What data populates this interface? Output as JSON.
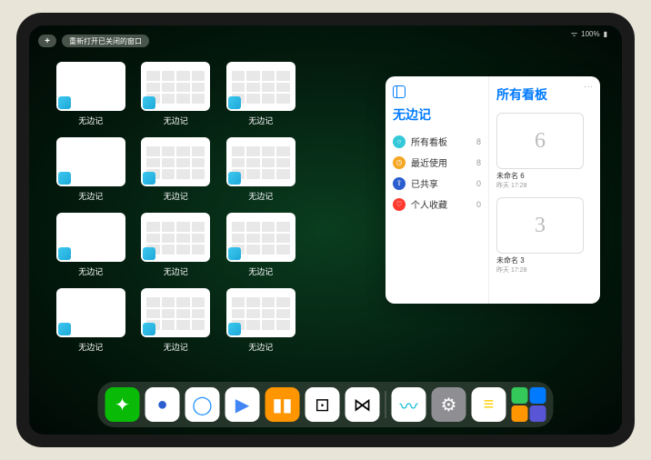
{
  "status": {
    "wifi": "wifi",
    "battery": "100%"
  },
  "controls": {
    "add": "+",
    "reopen": "重新打开已关闭的窗口"
  },
  "app_name": "无边记",
  "stage": {
    "windows": [
      {
        "type": "empty"
      },
      {
        "type": "grid"
      },
      {
        "type": "grid"
      },
      null,
      {
        "type": "empty"
      },
      {
        "type": "grid"
      },
      {
        "type": "grid"
      },
      null,
      {
        "type": "empty"
      },
      {
        "type": "grid"
      },
      {
        "type": "grid"
      },
      null,
      {
        "type": "empty"
      },
      {
        "type": "grid"
      },
      {
        "type": "grid"
      },
      null
    ]
  },
  "panel": {
    "left_title": "无边记",
    "right_title": "所有看板",
    "menu": "···",
    "items": [
      {
        "icon_color": "#34c8d9",
        "icon": "○",
        "label": "所有看板",
        "count": "8"
      },
      {
        "icon_color": "#f5a623",
        "icon": "◷",
        "label": "最近使用",
        "count": "8"
      },
      {
        "icon_color": "#2b5fcf",
        "icon": "⇪",
        "label": "已共享",
        "count": "0"
      },
      {
        "icon_color": "#ff3b30",
        "icon": "♡",
        "label": "个人收藏",
        "count": "0"
      }
    ],
    "boards": [
      {
        "glyph": "6",
        "name": "未命名 6",
        "time": "昨天 17:28"
      },
      {
        "glyph": "3",
        "name": "未命名 3",
        "time": "昨天 17:28"
      }
    ]
  },
  "dock": {
    "apps": [
      {
        "name": "wechat",
        "bg": "#09bb07",
        "glyph": "✦"
      },
      {
        "name": "quark",
        "bg": "#ffffff",
        "glyph": "●",
        "fg": "#2b5fcf"
      },
      {
        "name": "qqbrowser",
        "bg": "#ffffff",
        "glyph": "◯",
        "fg": "#1e90ff"
      },
      {
        "name": "play",
        "bg": "#ffffff",
        "glyph": "▶",
        "fg": "#4285f4"
      },
      {
        "name": "books",
        "bg": "#ff9500",
        "glyph": "▮▮",
        "fg": "#fff"
      },
      {
        "name": "dice",
        "bg": "#ffffff",
        "glyph": "⊡",
        "fg": "#000"
      },
      {
        "name": "sync",
        "bg": "#ffffff",
        "glyph": "⋈",
        "fg": "#000"
      }
    ],
    "recent": [
      {
        "name": "freeform",
        "bg": "#ffffff",
        "glyph": "〰",
        "fg": "#00b8d4"
      },
      {
        "name": "settings",
        "bg": "#8e8e93",
        "glyph": "⚙",
        "fg": "#fff"
      },
      {
        "name": "notes",
        "bg": "#ffffff",
        "glyph": "≡",
        "fg": "#ffcc00"
      }
    ]
  }
}
